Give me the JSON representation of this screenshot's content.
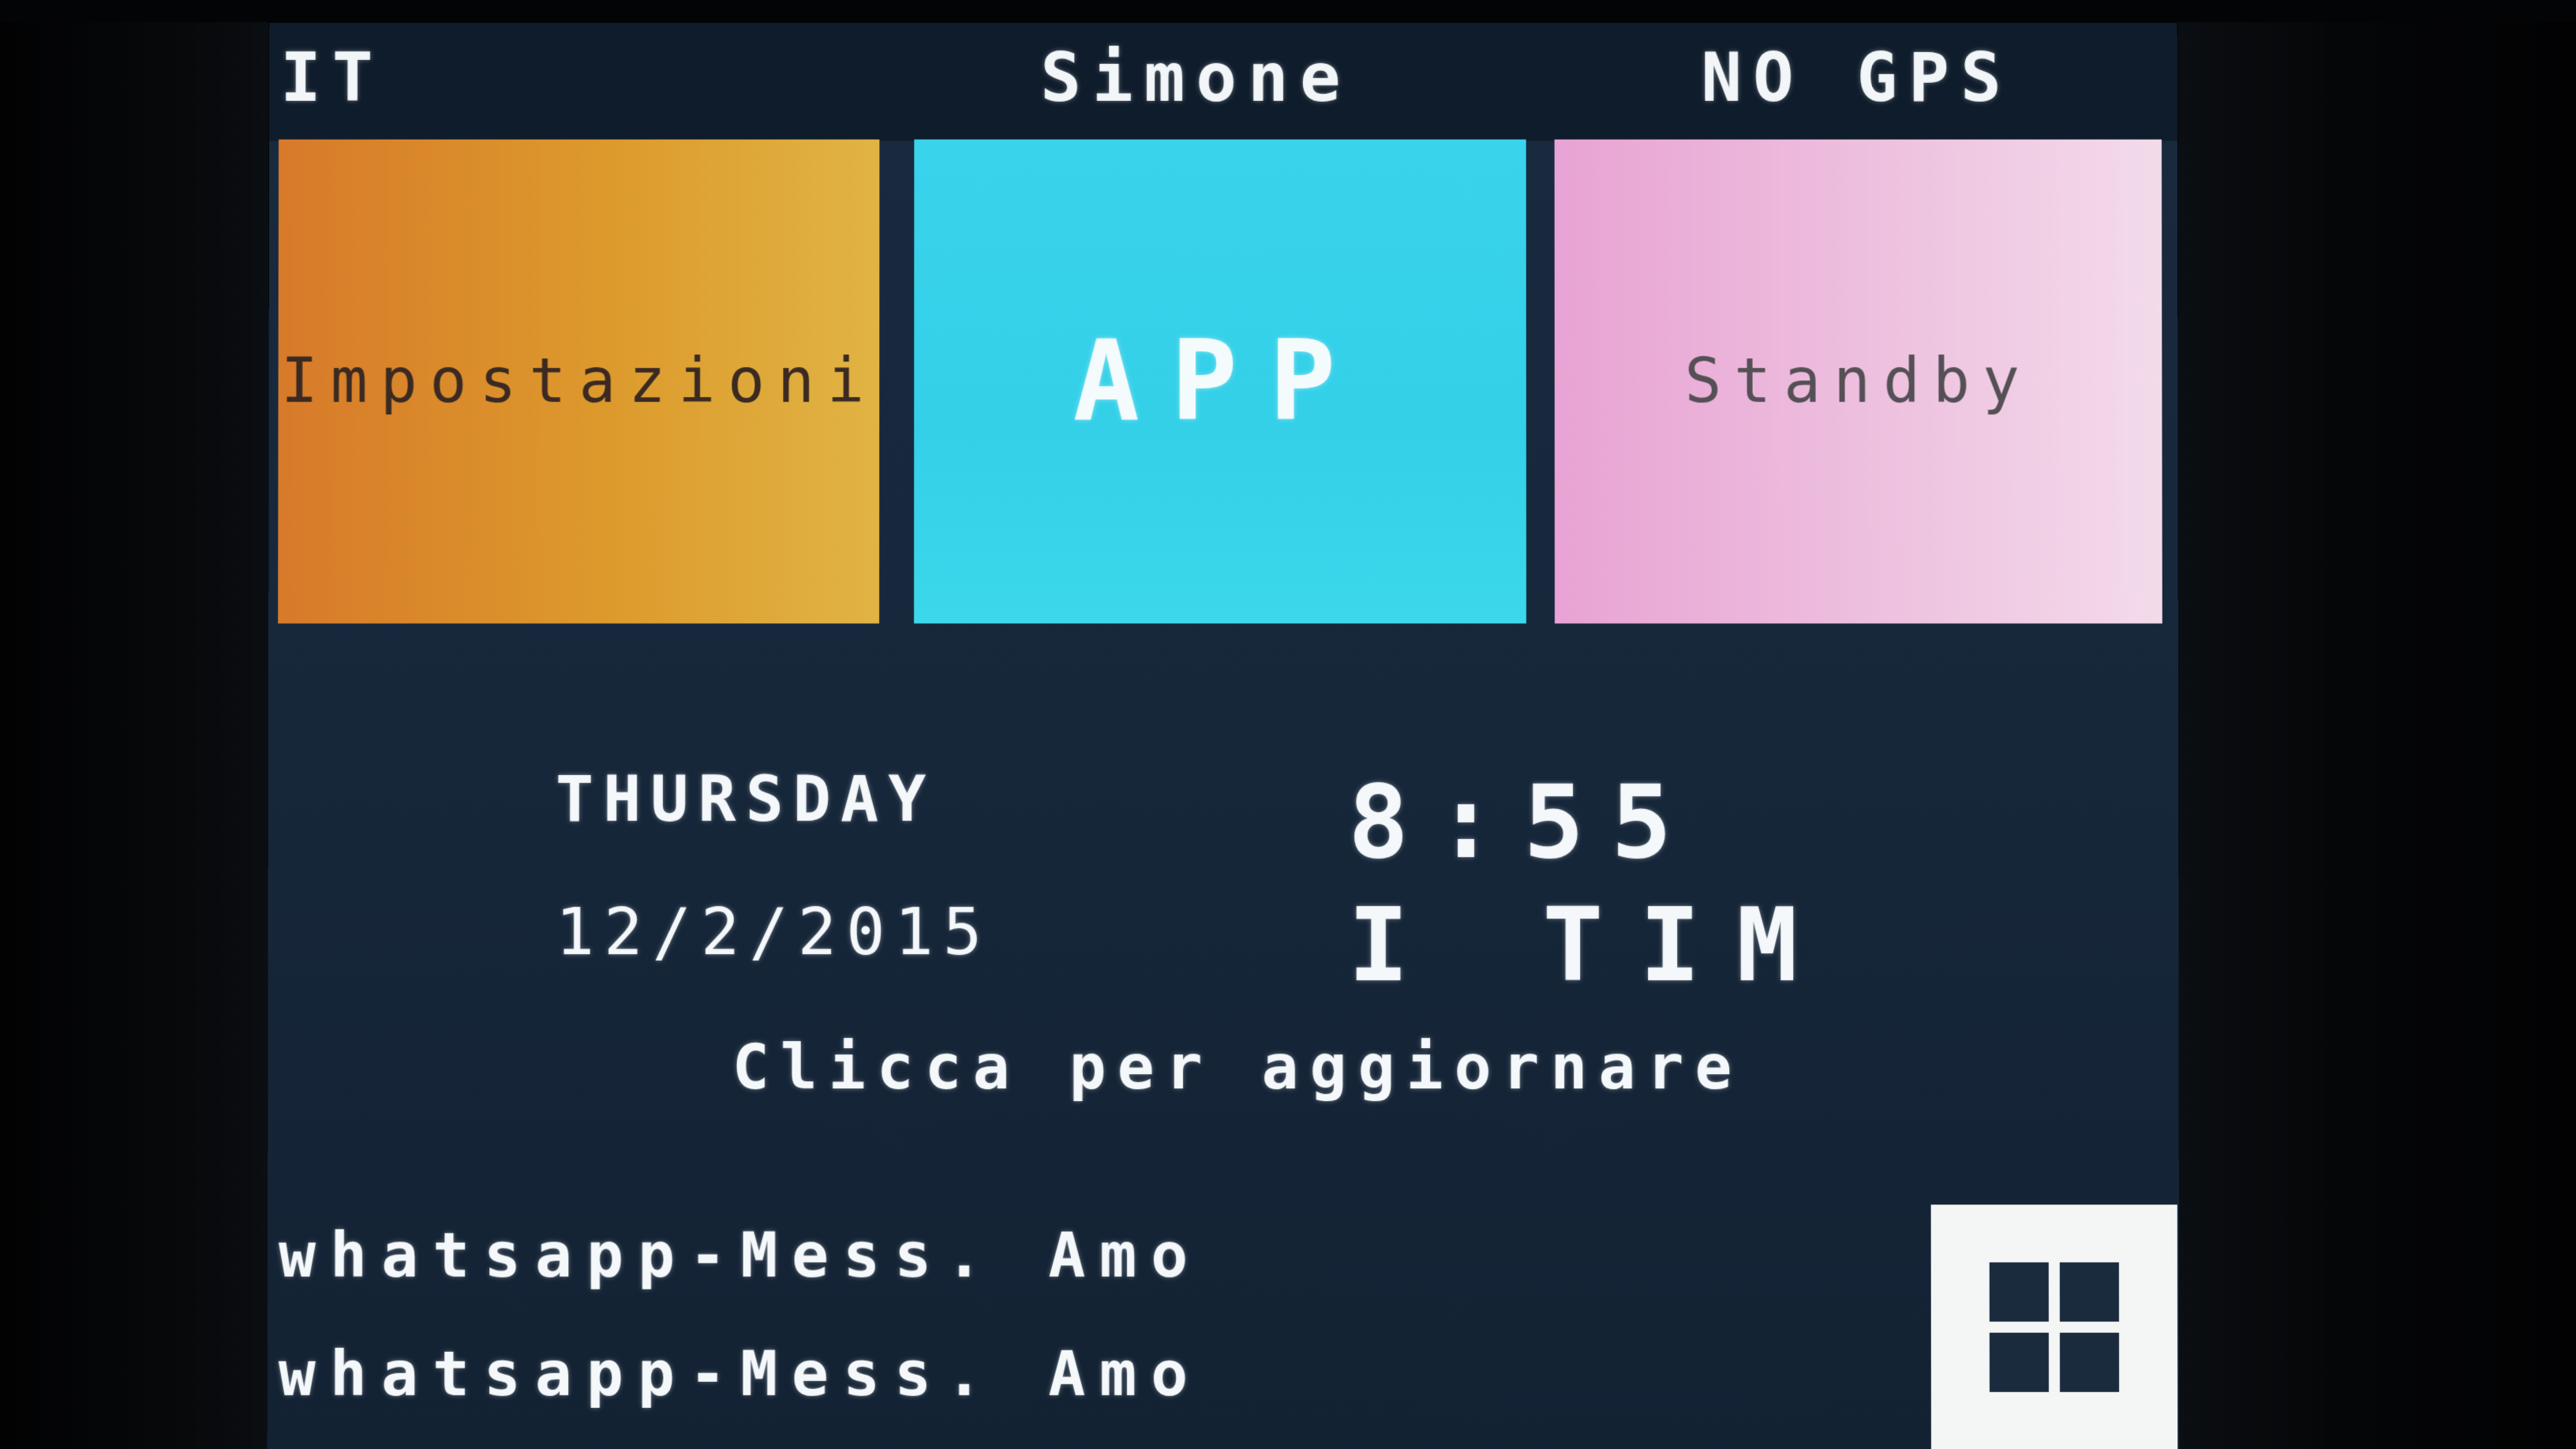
{
  "status_bar": {
    "language": "IT",
    "user_name": "Simone",
    "gps_status": "NO GPS"
  },
  "tiles": {
    "settings": {
      "label": "Impostazioni",
      "color": "#dd9a2c"
    },
    "app": {
      "label": "APP",
      "color": "#33d0e8"
    },
    "standby": {
      "label": "Standby",
      "color": "#eec4e0"
    }
  },
  "info": {
    "day": "THURSDAY",
    "date": "12/2/2015",
    "time": "8:55",
    "carrier": "I TIM",
    "refresh_hint": "Clicca per aggiornare"
  },
  "notifications": [
    {
      "text": "whatsapp-Mess. Amo"
    },
    {
      "text": "whatsapp-Mess. Amo"
    }
  ],
  "start_button": {
    "icon": "windows-grid-icon"
  },
  "colors": {
    "screen_background": "#17283c",
    "text": "#f4f8fa"
  }
}
